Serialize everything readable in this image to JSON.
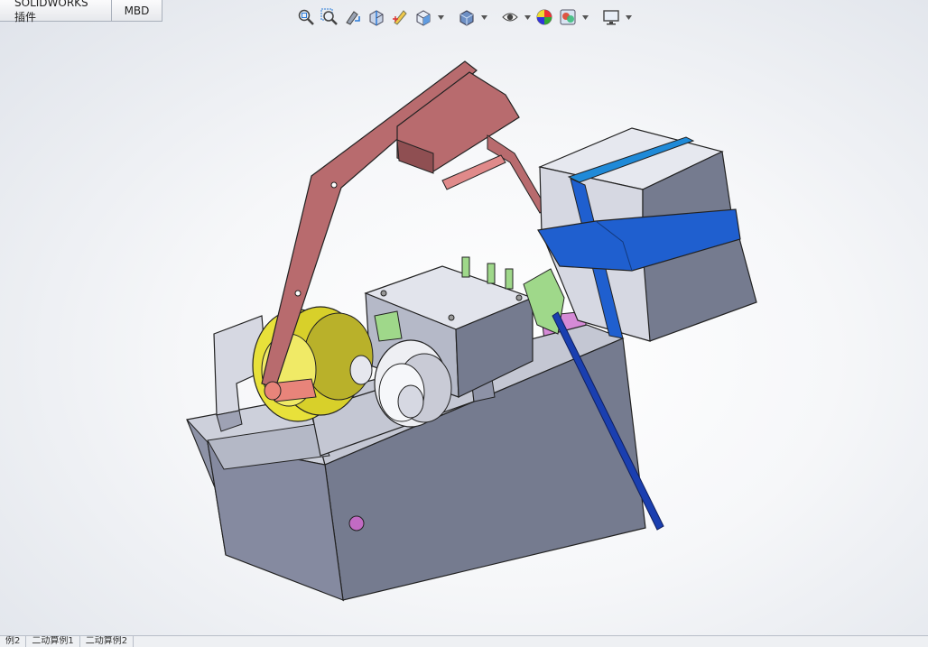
{
  "command_manager": {
    "tabs": [
      {
        "label": "SOLIDWORKS 插件"
      },
      {
        "label": "MBD"
      }
    ]
  },
  "heads_up_toolbar": {
    "icons": [
      "zoom-to-fit-icon",
      "zoom-to-area-icon",
      "previous-view-icon",
      "section-view-icon",
      "dynamic-annotation-view-icon",
      "view-orientation-icon",
      "display-style-icon",
      "hide-show-items-icon",
      "edit-appearance-icon",
      "apply-scene-icon",
      "view-settings-icon"
    ]
  },
  "model": {
    "colors": {
      "base": "#757b8f",
      "base_top": "#c9cbd6",
      "arm": "#b86b6e",
      "gear": "#e8e13a",
      "blue_band": "#1f5fcf",
      "green": "#9fd88a",
      "magenta": "#c16bc3",
      "block": "#d6d8e2"
    }
  },
  "sheet_tabs": [
    {
      "label": "例2"
    },
    {
      "label": "二动算例1"
    },
    {
      "label": "二动算例2"
    }
  ]
}
